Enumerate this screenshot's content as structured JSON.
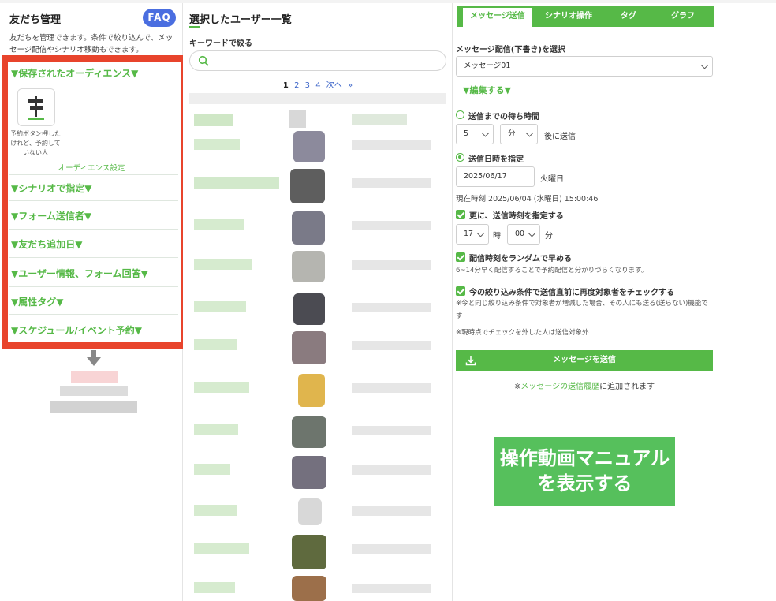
{
  "left": {
    "title": "友だち管理",
    "faq": "FAQ",
    "description": "友だちを管理できます。条件で絞り込んで、メッセージ配信やシナリオ移動もできます。",
    "sections": {
      "saved_audience": "▼保存されたオーディエンス▼",
      "audience_caption": "予約ボタン押したけれど、予約していない人",
      "audience_setting": "オーディエンス設定",
      "scenario": "▼シナリオで指定▼",
      "form_sender": "▼フォーム送信者▼",
      "friend_added": "▼友だち追加日▼",
      "user_info": "▼ユーザー情報、フォーム回答▼",
      "attr_tag": "▼属性タグ▼",
      "schedule": "▼スケジュール/イベント予約▼"
    }
  },
  "middle": {
    "title": "選択したユーザー一覧",
    "keyword_label": "キーワードで絞る",
    "search_placeholder": "",
    "pager": [
      "1",
      "2",
      "3",
      "4",
      "次へ",
      "»"
    ]
  },
  "right": {
    "tabs": [
      "メッセージ送信",
      "シナリオ操作",
      "タグ",
      "グラフ"
    ],
    "select_label": "メッセージ配信(下書き)を選択",
    "select_value": "メッセージ01",
    "edit_link": "▼編集する▼",
    "wait_label": "送信までの待ち時間",
    "wait_value": "5",
    "wait_unit": "分",
    "wait_suffix": "後に送信",
    "datetime_label": "送信日時を指定",
    "date_value": "2025/06/17",
    "weekday": "火曜日",
    "current_time": "現在時刻 2025/06/04 (水曜日) 15:00:46",
    "time_check_label": "更に、送信時刻を指定する",
    "hour_value": "17",
    "hour_unit": "時",
    "minute_value": "00",
    "minute_unit": "分",
    "random_check_label": "配信時刻をランダムで早める",
    "random_note": "6~14分早く配信することで予約配信と分かりづらくなります。",
    "recheck_label": "今の絞り込み条件で送信直前に再度対象者をチェックする",
    "recheck_note": "※今と同じ絞り込み条件で対象者が増減した場合、その人にも送る(送らない)機能です",
    "uncheck_note": "※現時点でチェックを外した人は送信対象外",
    "send_button": "メッセージを送信",
    "history_prefix": "※",
    "history_link": "メッセージの送信履歴",
    "history_suffix": "に追加されます",
    "manual_line1": "操作動画マニュアル",
    "manual_line2": "を表示する"
  },
  "colors": {
    "accent_green": "#56b947",
    "highlight_red": "#e8442c",
    "faq_blue": "#4a6ee0",
    "manual_green": "#56c05c"
  }
}
